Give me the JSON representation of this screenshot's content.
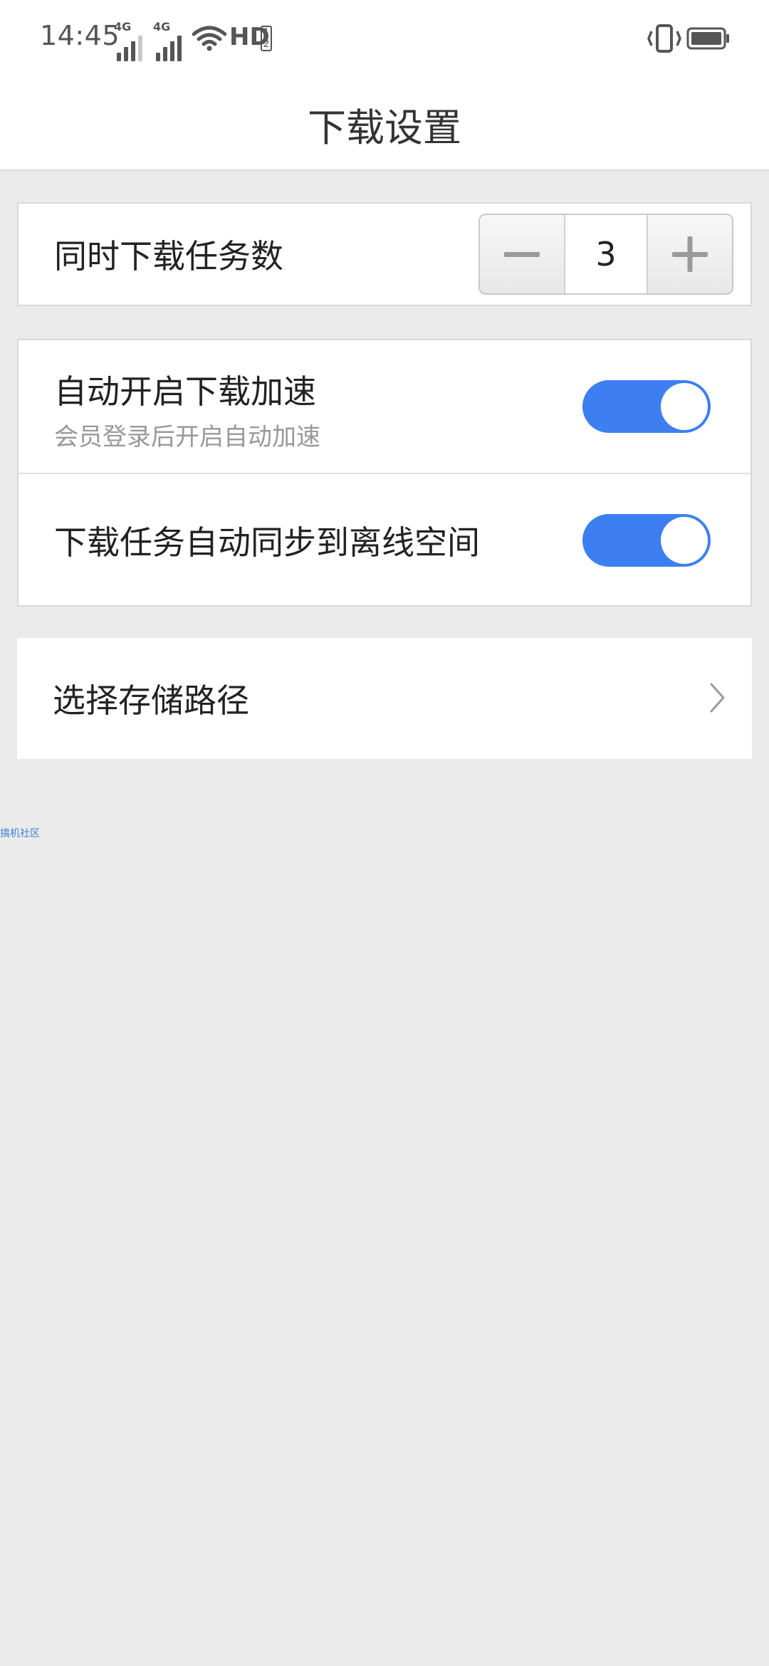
{
  "status_bar": {
    "time": "14:45",
    "signal1_label": "4G",
    "signal2_label": "4G",
    "hd_label": "HD",
    "hd_sub": "1 2",
    "icons": [
      "signal-icon",
      "signal-icon",
      "wifi-icon",
      "vibrate-icon",
      "battery-icon"
    ]
  },
  "header": {
    "title": "下载设置"
  },
  "concurrent": {
    "label": "同时下载任务数",
    "value": "3",
    "minus_icon": "minus-icon",
    "plus_icon": "plus-icon"
  },
  "accelerate": {
    "label": "自动开启下载加速",
    "sub": "会员登录后开启自动加速",
    "enabled": true
  },
  "sync": {
    "label": "下载任务自动同步到离线空间",
    "enabled": true
  },
  "storage": {
    "label": "选择存储路径",
    "icon": "chevron-right-icon"
  },
  "watermark": "搞机社区",
  "colors": {
    "accent": "#3d7ff0",
    "background": "#ebebeb",
    "card": "#ffffff"
  }
}
